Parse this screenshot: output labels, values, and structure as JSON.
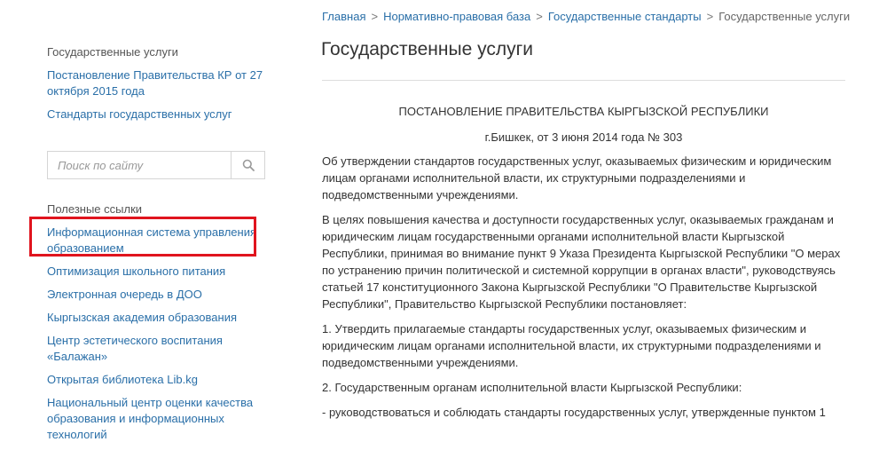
{
  "breadcrumb": {
    "items": [
      "Главная",
      "Нормативно-правовая база",
      "Государственные стандарты"
    ],
    "separator": ">",
    "current": "Государственные услуги"
  },
  "page_title": "Государственные услуги",
  "sidebar": {
    "group1": {
      "heading": "Государственные услуги",
      "links": [
        "Постановление Правительства КР от 27 октября 2015 года",
        "Стандарты государственных услуг"
      ]
    },
    "search": {
      "placeholder": "Поиск по сайту",
      "icon": "search-icon"
    },
    "group2": {
      "heading": "Полезные ссылки",
      "links": [
        "Информационная система управления образованием",
        "Оптимизация школьного питания",
        "Электронная очередь в ДОО",
        "Кыргызская академия образования",
        "Центр эстетического воспитания «Балажан»",
        "Открытая библиотека Lib.kg",
        "Национальный центр оценки качества образования и информационных технологий"
      ]
    }
  },
  "content": {
    "decree_title": "ПОСТАНОВЛЕНИЕ ПРАВИТЕЛЬСТВА КЫРГЫЗСКОЙ РЕСПУБЛИКИ",
    "decree_place": "г.Бишкек, от 3 июня 2014 года № 303",
    "paragraphs": [
      "Об утверждении стандартов государственных услуг, оказываемых физическим и юридическим лицам органами исполнительной власти, их структурными подразделениями и подведомственными учреждениями.",
      "В целях повышения качества и доступности государственных услуг, оказываемых гражданам и юридическим лицам государственными органами исполнительной власти Кыргызской Республики, принимая во внимание пункт 9 Указа Президента Кыргызской Республики \"О мерах по устранению причин политической и системной коррупции в органах власти\", руководствуясь статьей 17 конституционного Закона Кыргызской Республики \"О Правительстве Кыргызской Республики\", Правительство Кыргызской Республики постановляет:",
      "1. Утвердить прилагаемые стандарты государственных услуг, оказываемых физическим и юридическим лицам органами исполнительной власти, их структурными подразделениями и подведомственными учреждениями.",
      "2. Государственным органам исполнительной власти Кыргызской Республики:",
      "- руководствоваться и соблюдать стандарты государственных услуг, утвержденные пунктом 1"
    ]
  },
  "colors": {
    "link": "#2a6fa8",
    "highlight": "#e0141e",
    "text": "#333333"
  }
}
